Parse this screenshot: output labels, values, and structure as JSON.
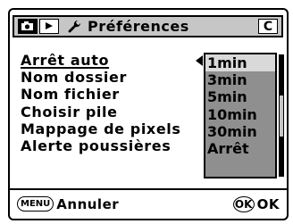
{
  "header": {
    "title": "Préférences",
    "mode_indicator": "C",
    "tabs": [
      {
        "name": "camera-icon"
      },
      {
        "name": "playback-icon"
      }
    ],
    "wrench_icon": "wrench-icon"
  },
  "menu": {
    "items": [
      {
        "label": "Arrêt auto"
      },
      {
        "label": "Nom dossier"
      },
      {
        "label": "Nom fichier"
      },
      {
        "label": "Choisir pile"
      },
      {
        "label": "Mappage de pixels"
      },
      {
        "label": "Alerte poussières"
      }
    ]
  },
  "dropdown": {
    "options": [
      "1min",
      "3min",
      "5min",
      "10min",
      "30min",
      "Arrêt"
    ],
    "selected": "1min"
  },
  "footer": {
    "cancel_key": "MENU",
    "cancel_label": "Annuler",
    "ok_key": "OK",
    "ok_label": "OK"
  },
  "colors": {
    "tabbar": "#c6c6c6",
    "dropdown": "#8f8f8f",
    "selected_option": "#d9d9d9"
  }
}
